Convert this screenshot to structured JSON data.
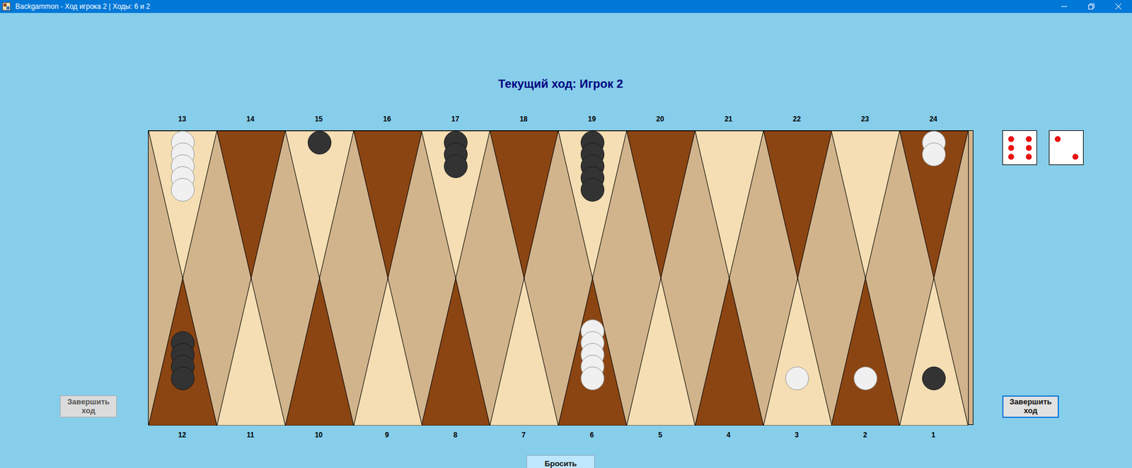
{
  "window": {
    "title": "Backgammon - Ход игрока 2 | Ходы: 6 и 2"
  },
  "heading": "Текущий ход: Игрок 2",
  "board": {
    "top_points": [
      {
        "label": "13",
        "color": "#f5deb3",
        "checkers": [
          "#f0f0f0",
          "#f0f0f0",
          "#f0f0f0",
          "#f0f0f0",
          "#f0f0f0"
        ]
      },
      {
        "label": "14",
        "color": "#8b4513",
        "checkers": []
      },
      {
        "label": "15",
        "color": "#f5deb3",
        "checkers": [
          "#333333"
        ]
      },
      {
        "label": "16",
        "color": "#8b4513",
        "checkers": []
      },
      {
        "label": "17",
        "color": "#f5deb3",
        "checkers": [
          "#333333",
          "#333333",
          "#333333"
        ]
      },
      {
        "label": "18",
        "color": "#8b4513",
        "checkers": []
      },
      {
        "label": "19",
        "color": "#f5deb3",
        "checkers": [
          "#333333",
          "#333333",
          "#333333",
          "#333333",
          "#333333"
        ]
      },
      {
        "label": "20",
        "color": "#8b4513",
        "checkers": []
      },
      {
        "label": "21",
        "color": "#f5deb3",
        "checkers": []
      },
      {
        "label": "22",
        "color": "#8b4513",
        "checkers": []
      },
      {
        "label": "23",
        "color": "#f5deb3",
        "checkers": []
      },
      {
        "label": "24",
        "color": "#8b4513",
        "checkers": [
          "#f0f0f0",
          "#f0f0f0"
        ]
      }
    ],
    "bottom_points": [
      {
        "label": "12",
        "color": "#8b4513",
        "checkers": [
          "#333333",
          "#333333",
          "#333333",
          "#333333"
        ]
      },
      {
        "label": "11",
        "color": "#f5deb3",
        "checkers": []
      },
      {
        "label": "10",
        "color": "#8b4513",
        "checkers": []
      },
      {
        "label": "9",
        "color": "#f5deb3",
        "checkers": []
      },
      {
        "label": "8",
        "color": "#8b4513",
        "checkers": []
      },
      {
        "label": "7",
        "color": "#f5deb3",
        "checkers": []
      },
      {
        "label": "6",
        "color": "#8b4513",
        "checkers": [
          "#f0f0f0",
          "#f0f0f0",
          "#f0f0f0",
          "#f0f0f0",
          "#f0f0f0"
        ]
      },
      {
        "label": "5",
        "color": "#f5deb3",
        "checkers": []
      },
      {
        "label": "4",
        "color": "#8b4513",
        "checkers": []
      },
      {
        "label": "3",
        "color": "#f5deb3",
        "checkers": [
          "#f0f0f0"
        ]
      },
      {
        "label": "2",
        "color": "#8b4513",
        "checkers": [
          "#f0f0f0"
        ]
      },
      {
        "label": "1",
        "color": "#f5deb3",
        "checkers": [
          "#333333"
        ]
      }
    ]
  },
  "dice": [
    {
      "value": 6
    },
    {
      "value": 2
    }
  ],
  "end_turn_buttons": [
    {
      "label": "Завершить ход",
      "disabled": true,
      "focused": false
    },
    {
      "label": "Завершить ход",
      "disabled": false,
      "focused": true
    }
  ],
  "roll_button": {
    "label": "Бросить"
  }
}
